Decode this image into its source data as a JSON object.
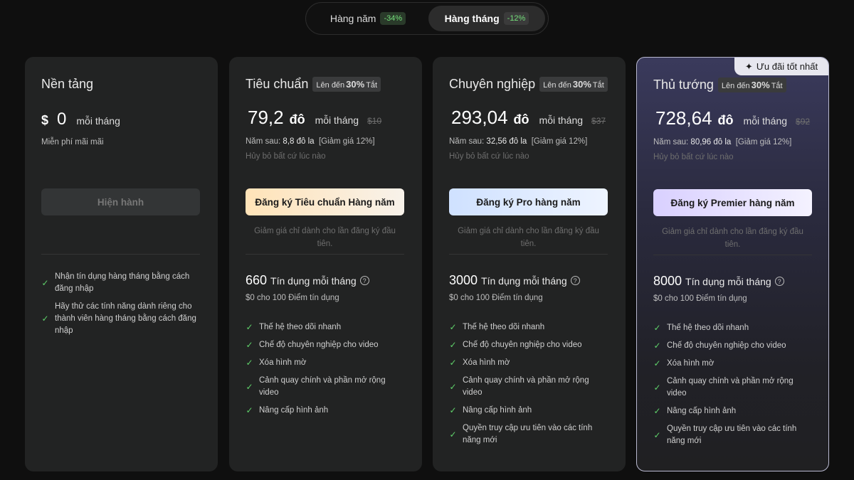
{
  "toggle": {
    "annual_label": "Hàng năm",
    "annual_badge": "-34%",
    "monthly_label": "Hàng tháng",
    "monthly_badge": "-12%",
    "selected": "monthly"
  },
  "plans": [
    {
      "name": "Nền tảng",
      "currency": "$",
      "price": "0",
      "period": "mỗi tháng",
      "note": "Miễn phí mãi mãi",
      "cta": "Hiện hành",
      "features": [
        "Nhận tín dụng hàng tháng bằng cách đăng nhập",
        "Hãy thử các tính năng dành riêng cho thành viên hàng tháng bằng cách đăng nhập"
      ]
    },
    {
      "name": "Tiêu chuẩn",
      "discount_prefix": "Lên đến",
      "discount_value": "30%",
      "discount_suffix": "Tắt",
      "price": "79,2",
      "unit": "đô",
      "period": "mỗi tháng",
      "old_price": "$10",
      "next_year_prefix": "Năm sau:",
      "next_year_value": "8,8 đô la",
      "next_year_discount": "[Giảm giá 12%]",
      "cancel_note": "Hủy bỏ bất cứ lúc nào",
      "cta": "Đăng ký Tiêu chuẩn Hàng năm",
      "first_note": "Giảm giá chỉ dành cho lần đăng ký đầu tiên.",
      "credits_num": "660",
      "credits_label": "Tín dụng mỗi tháng",
      "credit_price": "$0 cho 100 Điểm tín dụng",
      "features": [
        "Thế hệ theo dõi nhanh",
        "Chế độ chuyên nghiệp cho video",
        "Xóa hình mờ",
        "Cảnh quay chính và phần mở rộng video",
        "Nâng cấp hình ảnh"
      ]
    },
    {
      "name": "Chuyên nghiệp",
      "discount_prefix": "Lên đến",
      "discount_value": "30%",
      "discount_suffix": "Tắt",
      "price": "293,04",
      "unit": "đô",
      "period": "mỗi tháng",
      "old_price": "$37",
      "next_year_prefix": "Năm sau:",
      "next_year_value": "32,56 đô la",
      "next_year_discount": "[Giảm giá 12%]",
      "cancel_note": "Hủy bỏ bất cứ lúc nào",
      "cta": "Đăng ký Pro hàng năm",
      "first_note": "Giảm giá chỉ dành cho lần đăng ký đầu tiên.",
      "credits_num": "3000",
      "credits_label": "Tín dụng mỗi tháng",
      "credit_price": "$0 cho 100 Điểm tín dụng",
      "features": [
        "Thế hệ theo dõi nhanh",
        "Chế độ chuyên nghiệp cho video",
        "Xóa hình mờ",
        "Cảnh quay chính và phần mở rộng video",
        "Nâng cấp hình ảnh",
        "Quyền truy cập ưu tiên vào các tính năng mới"
      ]
    },
    {
      "name": "Thủ tướng",
      "best_badge": "Ưu đãi tốt nhất",
      "discount_prefix": "Lên đến",
      "discount_value": "30%",
      "discount_suffix": "Tắt",
      "price": "728,64",
      "unit": "đô",
      "period": "mỗi tháng",
      "old_price": "$92",
      "next_year_prefix": "Năm sau:",
      "next_year_value": "80,96 đô la",
      "next_year_discount": "[Giảm giá 12%]",
      "cancel_note": "Hủy bỏ bất cứ lúc nào",
      "cta": "Đăng ký Premier hàng năm",
      "first_note": "Giảm giá chỉ dành cho lần đăng ký đầu tiên.",
      "credits_num": "8000",
      "credits_label": "Tín dụng mỗi tháng",
      "credit_price": "$0 cho 100 Điểm tín dụng",
      "features": [
        "Thế hệ theo dõi nhanh",
        "Chế độ chuyên nghiệp cho video",
        "Xóa hình mờ",
        "Cảnh quay chính và phần mở rộng video",
        "Nâng cấp hình ảnh",
        "Quyền truy cập ưu tiên vào các tính năng mới"
      ]
    }
  ],
  "colors": {
    "check": "#5fd16a",
    "badge_green": "#74e07a",
    "cta_standard": "#ffe3b8",
    "cta_pro": "#cfe1ff",
    "cta_premier": "#d9d0ff"
  },
  "icons": {
    "check": "check-icon",
    "help": "question-circle-icon",
    "sparkle": "sparkle-icon"
  }
}
